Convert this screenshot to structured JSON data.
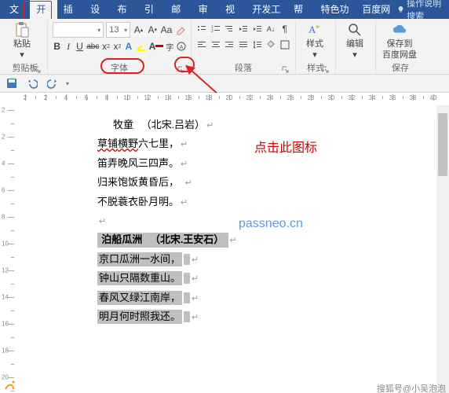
{
  "tabs": {
    "file": "文件",
    "home": "开始",
    "insert": "插入",
    "design": "设计",
    "layout": "布局",
    "references": "引用",
    "mailings": "邮件",
    "review": "审阅",
    "view": "视图",
    "devtools": "开发工具",
    "help": "帮助",
    "special": "特色功能",
    "baidu": "百度网盘",
    "tellme": "操作说明搜索"
  },
  "ribbon": {
    "clipboard": {
      "paste": "粘贴",
      "label": "剪贴板"
    },
    "font": {
      "name_placeholder": "",
      "size": "13",
      "bold": "B",
      "italic": "I",
      "underline": "U",
      "strike": "abc",
      "label": "字体"
    },
    "paragraph": {
      "label": "段落"
    },
    "styles": {
      "label": "样式"
    },
    "editing": {
      "label": "编辑"
    },
    "save": {
      "btn": "保存到",
      "btn2": "百度网盘",
      "label": "保存"
    }
  },
  "document": {
    "title1_a": "牧童",
    "title1_b": "（北宋.吕岩）",
    "l1_a": "草铺",
    "l1_b": "横野",
    "l1_c": "六七里，",
    "l2": "笛弄晚风三四声。",
    "l3": "归来饱饭黄昏后，",
    "l4": "不脱蓑衣卧月明。",
    "title2_a": "泊船瓜洲",
    "title2_b": "（北宋.王安石）",
    "s1": "京口瓜洲一水间，",
    "s2": "钟山只隔数重山。",
    "s3": "春风又绿江南岸，",
    "s4": "明月何时照我还。"
  },
  "annotations": {
    "callout": "点击此图标",
    "watermark": "passneo.cn",
    "attribution": "搜狐号@小吴泡泡"
  },
  "ruler": {
    "h": [
      "2",
      "2",
      "4",
      "6",
      "8",
      "10",
      "12",
      "14",
      "16",
      "18",
      "20",
      "22",
      "24",
      "26",
      "28",
      "30",
      "32",
      "34",
      "36",
      "38",
      "40"
    ],
    "v": [
      "2",
      "2",
      "4",
      "6",
      "8",
      "10",
      "12",
      "14",
      "16",
      "18",
      "20"
    ]
  }
}
